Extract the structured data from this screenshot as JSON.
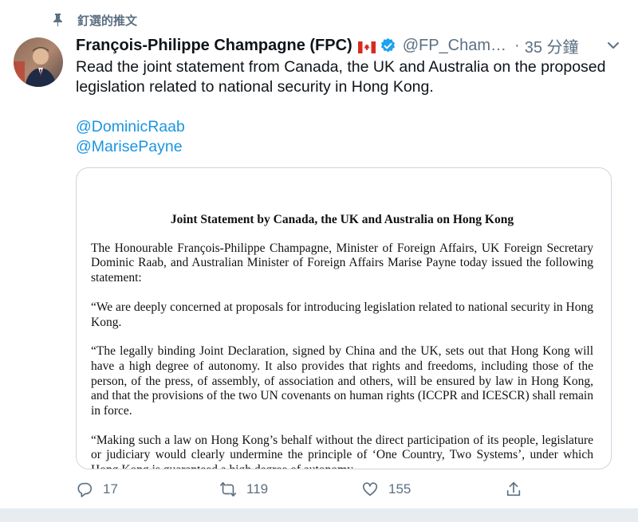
{
  "pinned_label": "釘選的推文",
  "author": {
    "name": "François-Philippe Champagne (FPC)",
    "handle": "@FP_Cham…",
    "separator": "·",
    "time": "35 分鐘"
  },
  "tweet_text": "Read the joint statement from Canada, the UK and Australia on the proposed legislation related to national security in Hong Kong.",
  "mentions": [
    "@DominicRaab",
    "@MarisePayne"
  ],
  "document": {
    "title": "Joint Statement by Canada, the UK and Australia on Hong Kong",
    "paragraphs": [
      "The Honourable François-Philippe Champagne, Minister of Foreign Affairs, UK Foreign Secretary Dominic Raab, and Australian Minister of Foreign Affairs Marise Payne today issued the following statement:",
      "“We are deeply concerned at proposals for introducing legislation related to national security in Hong Kong.",
      "“The legally binding Joint Declaration, signed by China and the UK, sets out that Hong Kong will have a high degree of autonomy.  It also provides that rights and freedoms, including those of the person, of the press, of assembly, of association and others, will be ensured by law in Hong Kong, and that the provisions of the two UN covenants on human rights (ICCPR and ICESCR) shall remain in force.",
      "“Making such a law on Hong Kong’s behalf without the direct participation of its people, legislature or judiciary would clearly undermine the principle of ‘One Country, Two Systems’, under which Hong Kong is guaranteed a high degree of autonomy."
    ]
  },
  "actions": {
    "reply_count": "17",
    "retweet_count": "119",
    "like_count": "155"
  },
  "colors": {
    "link": "#1b95e0",
    "secondary_text": "#5b7083",
    "verified": "#1da1f2",
    "canada_red": "#d52b1e"
  },
  "icons": [
    "pin-icon",
    "canada-flag-icon",
    "verified-badge-icon",
    "chevron-down-icon",
    "reply-icon",
    "retweet-icon",
    "like-icon",
    "share-icon"
  ]
}
